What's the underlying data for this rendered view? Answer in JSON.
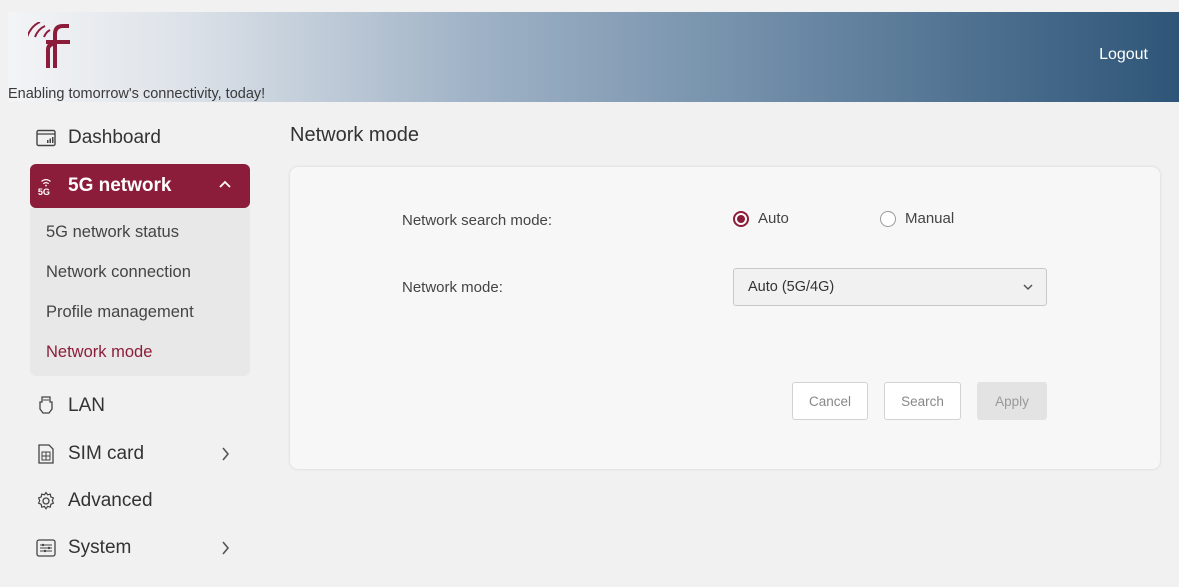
{
  "header": {
    "tagline": "Enabling tomorrow's connectivity, today!",
    "logout_label": "Logout",
    "logo_icon": "rf-wifi-logo-icon"
  },
  "sidebar": {
    "items": [
      {
        "label": "Dashboard",
        "icon": "dashboard-icon"
      },
      {
        "label": "5G network",
        "icon": "5g-icon",
        "expanded": true,
        "sub_items": [
          {
            "label": "5G network status"
          },
          {
            "label": "Network connection"
          },
          {
            "label": "Profile management"
          },
          {
            "label": "Network mode"
          }
        ]
      },
      {
        "label": "LAN",
        "icon": "ethernet-icon"
      },
      {
        "label": "SIM card",
        "icon": "sim-card-icon"
      },
      {
        "label": "Advanced",
        "icon": "gear-icon"
      },
      {
        "label": "System",
        "icon": "system-settings-icon"
      }
    ],
    "active_sub_item": "Network mode"
  },
  "main": {
    "title": "Network mode",
    "search_mode": {
      "label": "Network search mode:",
      "options": [
        "Auto",
        "Manual"
      ],
      "selected": "Auto"
    },
    "network_mode": {
      "label": "Network mode:",
      "value": "Auto (5G/4G)"
    },
    "buttons": {
      "cancel": "Cancel",
      "search": "Search",
      "apply": "Apply"
    }
  },
  "colors": {
    "accent": "#8c1d3a",
    "header_start": "#f3f4f6",
    "header_end": "#2e5578",
    "background": "#f1f1f1"
  }
}
